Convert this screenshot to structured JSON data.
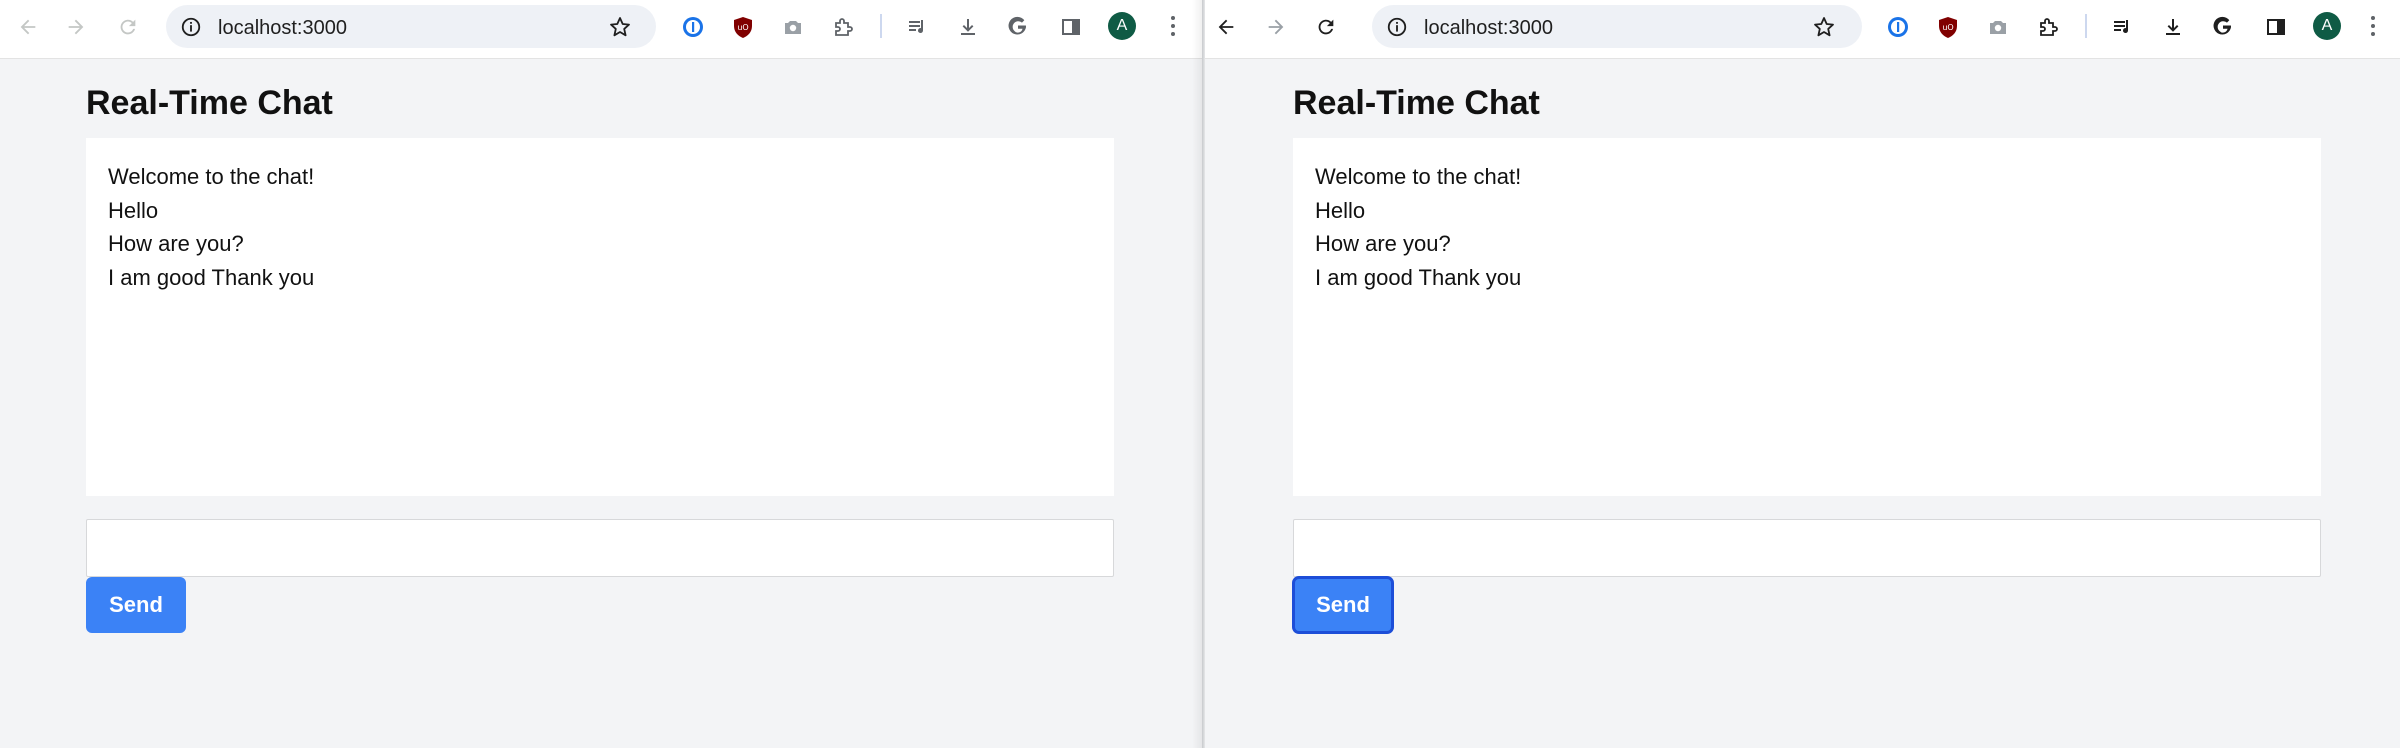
{
  "windows": [
    {
      "url": "localhost:3000",
      "page": {
        "title": "Real-Time Chat",
        "messages": [
          "Welcome to the chat!",
          "Hello",
          "How are you?",
          "I am good Thank you"
        ],
        "input": {
          "value": "",
          "placeholder": ""
        },
        "send_label": "Send"
      },
      "avatar_letter": "A"
    },
    {
      "url": "localhost:3000",
      "page": {
        "title": "Real-Time Chat",
        "messages": [
          "Welcome to the chat!",
          "Hello",
          "How are you?",
          "I am good Thank you"
        ],
        "input": {
          "value": "",
          "placeholder": ""
        },
        "send_label": "Send"
      },
      "avatar_letter": "A"
    }
  ],
  "toolbar_icons": [
    "back-icon",
    "forward-icon",
    "reload-icon",
    "site-info-icon",
    "bookmark-star-icon",
    "password-manager-icon",
    "ublock-icon",
    "screenshot-icon",
    "extensions-icon",
    "reading-list-icon",
    "download-icon",
    "google-icon",
    "side-panel-icon",
    "profile-avatar",
    "menu-icon"
  ],
  "colors": {
    "page_background": "#f3f4f6",
    "send_button": "#3b82f6",
    "send_text": "#ffffff",
    "avatar": "#0f5b45",
    "ublock": "#800000",
    "password_manager": "#1a73e8"
  }
}
